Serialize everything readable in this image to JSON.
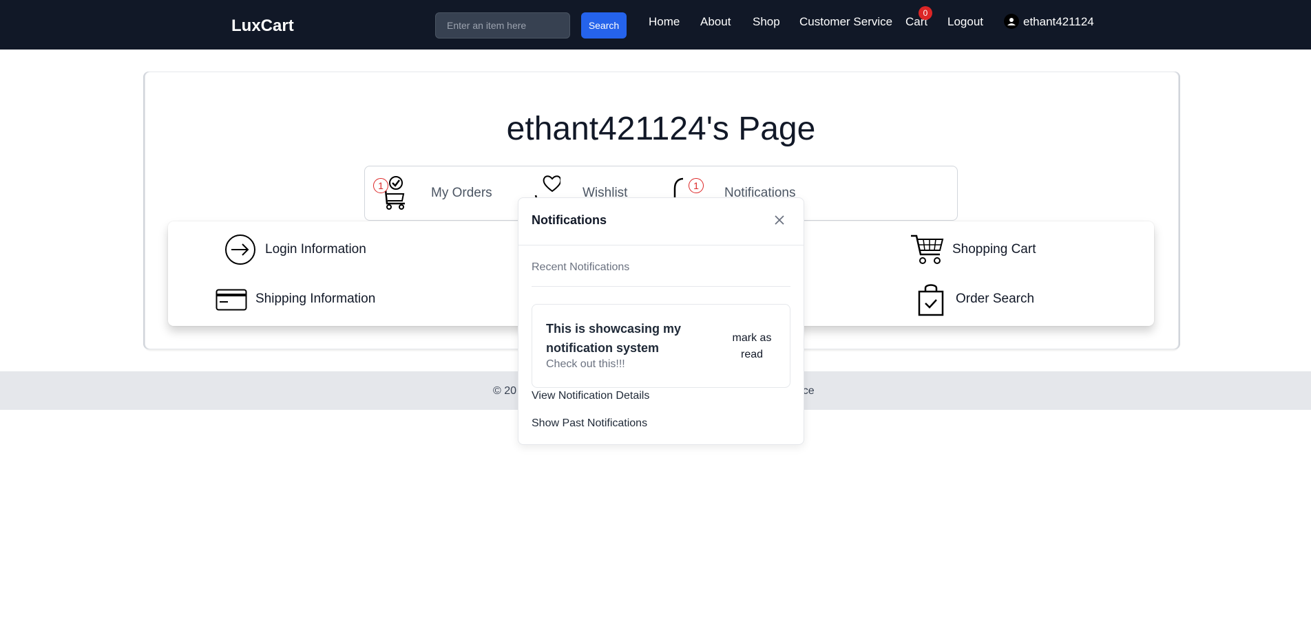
{
  "navbar": {
    "brand": "LuxCart",
    "search_placeholder": "Enter an item here",
    "search_button": "Search",
    "links": {
      "home": "Home",
      "about": "About",
      "shop": "Shop",
      "customer_service": "Customer Service",
      "cart": "Cart",
      "logout": "Logout"
    },
    "cart_count": "0",
    "username": "ethant421124",
    "user_icon": "user-icon"
  },
  "page": {
    "title": "ethant421124's Page"
  },
  "tabs": {
    "orders": {
      "label": "My Orders",
      "badge": "1",
      "icon": "cart-check-icon"
    },
    "wishlist": {
      "label": "Wishlist",
      "icon": "heart-hand-icon"
    },
    "notifications": {
      "label": "Notifications",
      "badge": "1",
      "icon": "bell-icon"
    }
  },
  "info_links": {
    "login": {
      "label": "Login Information",
      "icon": "arrow-right-circle-icon"
    },
    "shipping": {
      "label": "Shipping Information",
      "icon": "credit-card-icon"
    },
    "cart": {
      "label": "Shopping Cart",
      "icon": "shopping-cart-icon"
    },
    "order_search": {
      "label": "Order Search",
      "icon": "shopping-bag-check-icon"
    }
  },
  "footer": {
    "copyright_fragment": "© 20",
    "link_fragment": "ervice"
  },
  "notifications_popup": {
    "title": "Notifications",
    "close_icon": "close-icon",
    "section_label": "Recent Notifications",
    "items": [
      {
        "title": "This is showcasing my notification system",
        "subtitle": "Check out this!!!",
        "action": "mark as read"
      }
    ],
    "view_details": "View Notification Details",
    "show_past": "Show Past Notifications"
  },
  "colors": {
    "navbar_bg": "#111827",
    "search_button": "#2563eb",
    "badge_red": "#dc2626",
    "footer_bg": "#e5e7eb"
  }
}
